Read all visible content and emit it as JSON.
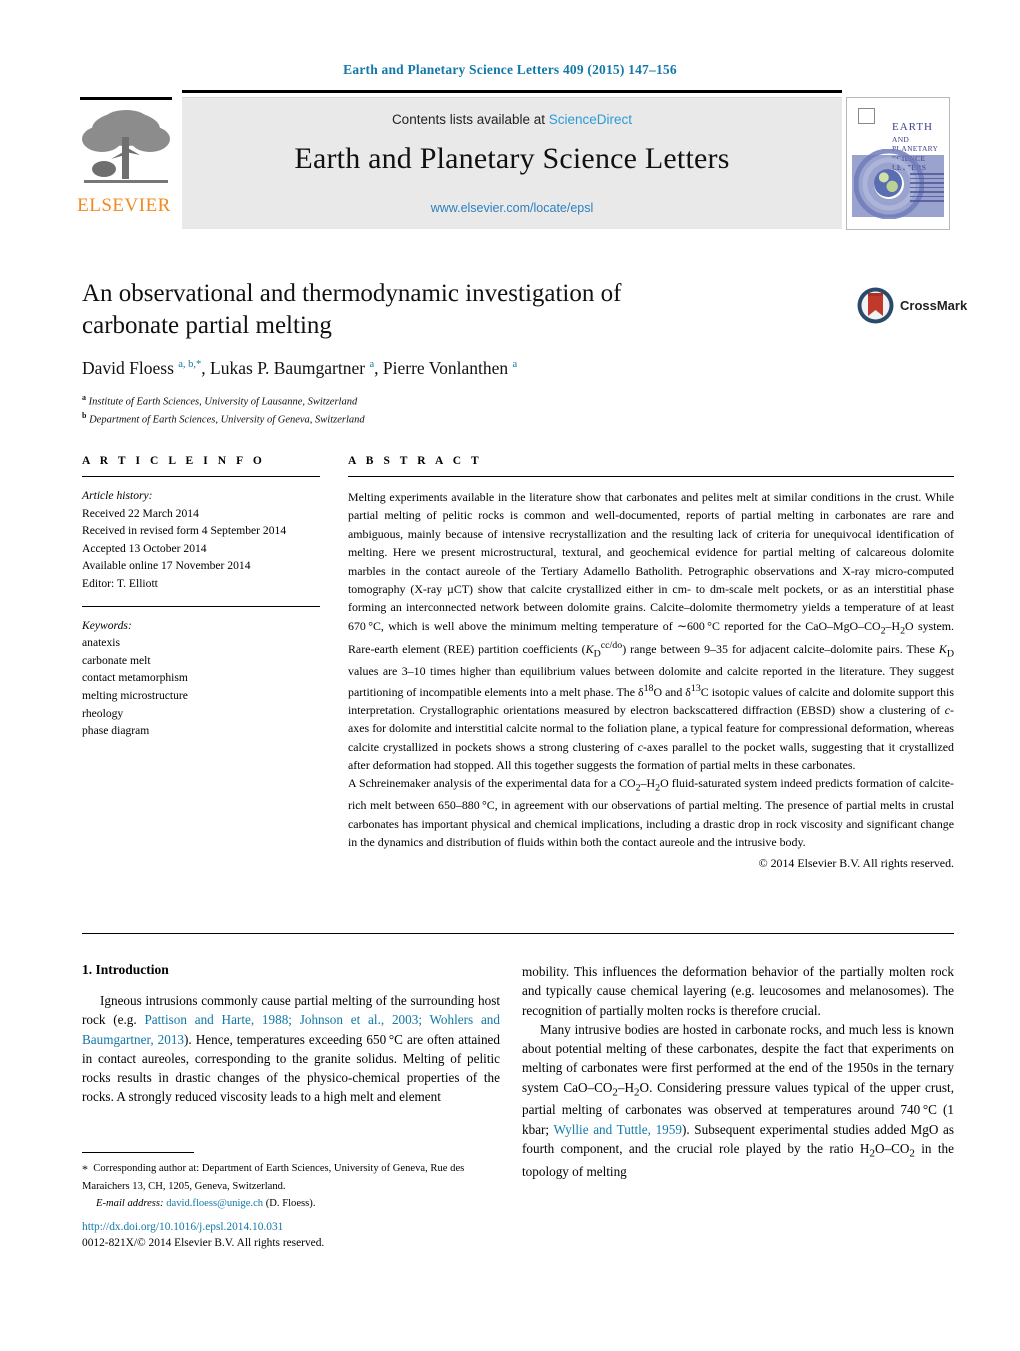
{
  "running_head": "Earth and Planetary Science Letters 409 (2015) 147–156",
  "masthead": {
    "contents_prefix": "Contents lists available at ",
    "sciencedirect": "ScienceDirect",
    "journal_title": "Earth and Planetary Science Letters",
    "journal_url": "www.elsevier.com/locate/epsl",
    "publisher_logo_word": "ELSEVIER",
    "cover_title_line1": "EARTH",
    "cover_title_line2": "AND PLANETARY",
    "cover_title_line3": "SCIENCE LETTERS",
    "brand_color": "#f18a21",
    "link_color": "#2e9bd6"
  },
  "article": {
    "title": "An observational and thermodynamic investigation of carbonate partial melting",
    "authors_html": "David Floess <sup>a, b,</sup><sup>*</sup>, Lukas P. Baumgartner <sup>a</sup>, Pierre Vonlanthen <sup>a</sup>",
    "affiliation_a": "Institute of Earth Sciences, University of Lausanne, Switzerland",
    "affiliation_b": "Department of Earth Sciences, University of Geneva, Switzerland",
    "crossmark_label": "CrossMark"
  },
  "info": {
    "heading": "A R T I C L E   I N F O",
    "history_label": "Article history:",
    "history": [
      "Received 22 March 2014",
      "Received in revised form 4 September 2014",
      "Accepted 13 October 2014",
      "Available online 17 November 2014",
      "Editor: T. Elliott"
    ],
    "keywords_label": "Keywords:",
    "keywords": [
      "anatexis",
      "carbonate melt",
      "contact metamorphism",
      "melting microstructure",
      "rheology",
      "phase diagram"
    ]
  },
  "abstract": {
    "heading": "A B S T R A C T",
    "paragraph1_html": "Melting experiments available in the literature show that carbonates and pelites melt at similar conditions in the crust. While partial melting of pelitic rocks is common and well-documented, reports of partial melting in carbonates are rare and ambiguous, mainly because of intensive recrystallization and the resulting lack of criteria for unequivocal identification of melting. Here we present microstructural, textural, and geochemical evidence for partial melting of calcareous dolomite marbles in the contact aureole of the Tertiary Adamello Batholith. Petrographic observations and X-ray micro-computed tomography (X-ray &#181;CT) show that calcite crystallized either in cm- to dm-scale melt pockets, or as an interstitial phase forming an interconnected network between dolomite grains. Calcite&#8211;dolomite thermometry yields a temperature of at least 670&#8201;&#176;C, which is well above the minimum melting temperature of &#8764;600&#8201;&#176;C reported for the CaO&#8211;MgO&#8211;CO<sub>2</sub>&#8211;H<sub>2</sub>O system. Rare-earth element (REE) partition coefficients (<i>K</i><sub>D</sub><sup>cc/do</sup>) range between 9&#8211;35 for adjacent calcite&#8211;dolomite pairs. These <i>K</i><sub>D</sub> values are 3&#8211;10 times higher than equilibrium values between dolomite and calcite reported in the literature. They suggest partitioning of incompatible elements into a melt phase. The &#948;<sup>18</sup>O and &#948;<sup>13</sup>C isotopic values of calcite and dolomite support this interpretation. Crystallographic orientations measured by electron backscattered diffraction (EBSD) show a clustering of <i>c</i>-axes for dolomite and interstitial calcite normal to the foliation plane, a typical feature for compressional deformation, whereas calcite crystallized in pockets shows a strong clustering of <i>c</i>-axes parallel to the pocket walls, suggesting that it crystallized after deformation had stopped. All this together suggests the formation of partial melts in these carbonates.",
    "paragraph2_html": "A Schreinemaker analysis of the experimental data for a CO<sub>2</sub>&#8211;H<sub>2</sub>O fluid-saturated system indeed predicts formation of calcite-rich melt between 650&#8211;880&#8201;&#176;C, in agreement with our observations of partial melting. The presence of partial melts in crustal carbonates has important physical and chemical implications, including a drastic drop in rock viscosity and significant change in the dynamics and distribution of fluids within both the contact aureole and the intrusive body.",
    "copyright": "© 2014 Elsevier B.V. All rights reserved."
  },
  "introduction": {
    "heading": "1. Introduction",
    "left_paragraph_html": "Igneous intrusions commonly cause partial melting of the surrounding host rock (e.g. <span class=\"ref-link\">Pattison and Harte, 1988; Johnson et al., 2003; Wohlers and Baumgartner, 2013</span>). Hence, temperatures exceeding 650&#8201;&#176;C are often attained in contact aureoles, corresponding to the granite solidus. Melting of pelitic rocks results in drastic changes of the physico-chemical properties of the rocks. A strongly reduced viscosity leads to a high melt and element",
    "right_paragraph1_html": "mobility. This influences the deformation behavior of the partially molten rock and typically cause chemical layering (e.g. leucosomes and melanosomes). The recognition of partially molten rocks is therefore crucial.",
    "right_paragraph2_html": "Many intrusive bodies are hosted in carbonate rocks, and much less is known about potential melting of these carbonates, despite the fact that experiments on melting of carbonates were first performed at the end of the 1950s in the ternary system CaO&#8211;CO<sub>2</sub>&#8211;H<sub>2</sub>O. Considering pressure values typical of the upper crust, partial melting of carbonates was observed at temperatures around 740&#8201;&#176;C (1 kbar; <span class=\"ref-link\">Wyllie and Tuttle, 1959</span>). Subsequent experimental studies added MgO as fourth component, and the crucial role played by the ratio H<sub>2</sub>O&#8211;CO<sub>2</sub> in the topology of melting"
  },
  "footnote": {
    "corresponding_html": "<span class=\"star\">*</span>&nbsp; Corresponding author at: Department of Earth Sciences, University of Geneva, Rue des Maraichers 13, CH, 1205, Geneva, Switzerland.",
    "email_label": "E-mail address:",
    "email": "david.floess@unige.ch",
    "email_suffix": "(D. Floess)."
  },
  "footer": {
    "doi": "http://dx.doi.org/10.1016/j.epsl.2014.10.031",
    "issn_line": "0012-821X/© 2014 Elsevier B.V. All rights reserved."
  }
}
